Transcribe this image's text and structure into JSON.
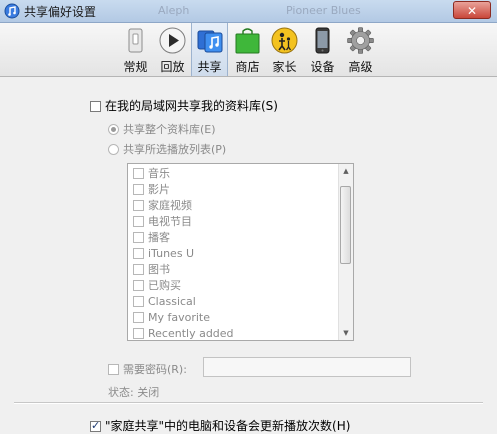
{
  "window": {
    "title": "共享偏好设置",
    "background_labels": [
      "Aleph",
      "Pioneer Blues"
    ],
    "close_label": "✕"
  },
  "tabs": [
    {
      "id": "general",
      "label": "常规",
      "icon": "device-switch-icon"
    },
    {
      "id": "playback",
      "label": "回放",
      "icon": "play-icon"
    },
    {
      "id": "sharing",
      "label": "共享",
      "icon": "music-note-icon",
      "active": true
    },
    {
      "id": "store",
      "label": "商店",
      "icon": "shopping-bag-icon"
    },
    {
      "id": "parental",
      "label": "家长",
      "icon": "parental-icon"
    },
    {
      "id": "devices",
      "label": "设备",
      "icon": "iphone-icon"
    },
    {
      "id": "advanced",
      "label": "高级",
      "icon": "gear-icon"
    }
  ],
  "sharing": {
    "share_library_label": "在我的局域网共享我的资料库(S)",
    "share_library_checked": false,
    "share_entire_label": "共享整个资料库(E)",
    "share_selected_label": "共享所选播放列表(P)",
    "selected_mode": "entire",
    "playlists": [
      "音乐",
      "影片",
      "家庭视频",
      "电视节目",
      "播客",
      "iTunes U",
      "图书",
      "已购买",
      "Classical",
      "My favorite",
      "Recently added"
    ],
    "require_password_label": "需要密码(R):",
    "password_value": "",
    "status_label": "状态: 关闭",
    "home_sharing_label": "\"家庭共享\"中的电脑和设备会更新播放次数(H)",
    "home_sharing_checked": true
  },
  "colors": {
    "accent": "#1e6fd0",
    "titlebar": "#c3d6ed",
    "close_button": "#c9473a"
  }
}
